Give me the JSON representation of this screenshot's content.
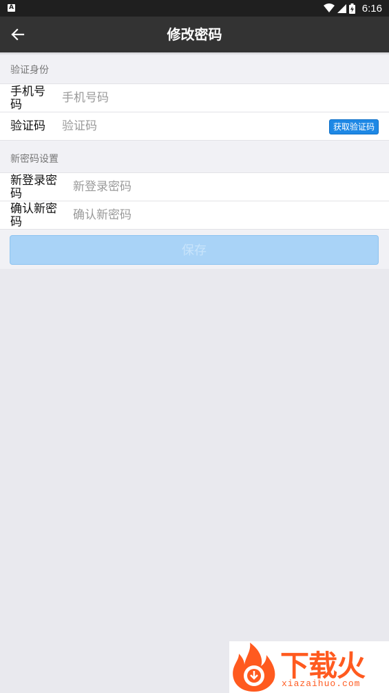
{
  "status_bar": {
    "time": "6:16",
    "notification_icon": "A"
  },
  "app_bar": {
    "title": "修改密码",
    "back_icon": "arrow-left-icon"
  },
  "verify_section": {
    "header": "验证身份",
    "phone": {
      "label": "手机号码",
      "placeholder": "手机号码"
    },
    "code": {
      "label": "验证码",
      "placeholder": "验证码",
      "button": "获取验证码"
    }
  },
  "password_section": {
    "header": "新密码设置",
    "new_password": {
      "label": "新登录密码",
      "placeholder": "新登录密码"
    },
    "confirm_password": {
      "label": "确认新密码",
      "placeholder": "确认新密码"
    }
  },
  "save_button": "保存",
  "watermark": {
    "text": "下载火",
    "sub": "xiazaihuo.com"
  },
  "colors": {
    "app_bar": "#333333",
    "accent": "#1e88e5",
    "save_disabled": "#a9d3f7",
    "brand": "#ff5a1f"
  }
}
